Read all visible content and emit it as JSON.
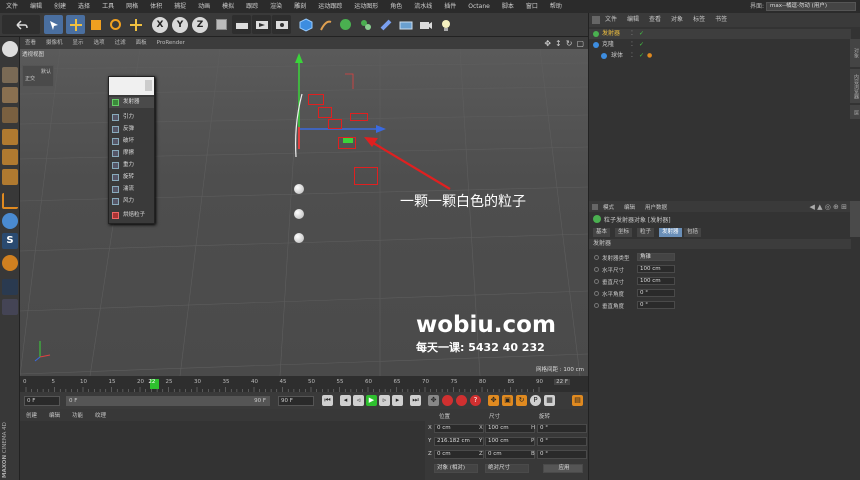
{
  "menubar": {
    "items": [
      "文件",
      "编辑",
      "创建",
      "选择",
      "工具",
      "网格",
      "体积",
      "捕捉",
      "动画",
      "模拟",
      "跟踪",
      "渲染",
      "雕刻",
      "运动跟踪",
      "运动图形",
      "角色",
      "流水线",
      "插件",
      "Octane",
      "脚本",
      "窗口",
      "帮助"
    ],
    "layout_label": "界面:",
    "layout_value": "max--橘逗-勿动 (用户)"
  },
  "viewport": {
    "menu": [
      "查看",
      "摄像机",
      "显示",
      "选项",
      "过滤",
      "面板",
      "ProRender"
    ],
    "title": "透视视图",
    "grid_info": "网格间距 : 100 cm",
    "mini_panel": "默认",
    "mini_value": "正交",
    "annotation": "一颗一颗白色的粒子",
    "watermark": "wobiu.com",
    "watermark_sub": "每天一课: 5432 40 232"
  },
  "popup": {
    "header": "",
    "items": [
      "发射器",
      "引力",
      "反弹",
      "破坏",
      "摩擦",
      "重力",
      "旋转",
      "湍流",
      "风力",
      "烘焙粒子"
    ]
  },
  "timeline": {
    "ticks": [
      "0",
      "5",
      "10",
      "15",
      "20",
      "22",
      "25",
      "30",
      "35",
      "40",
      "45",
      "50",
      "55",
      "60",
      "65",
      "70",
      "75",
      "80",
      "85",
      "90"
    ],
    "current_frame": "22",
    "end_label": "22 F"
  },
  "transport": {
    "start": "0 F",
    "min": "0 F",
    "max": "90 F",
    "end": "90 F"
  },
  "material": {
    "menu": [
      "创建",
      "编辑",
      "功能",
      "纹理"
    ]
  },
  "coords": {
    "headers": [
      "位置",
      "尺寸",
      "旋转"
    ],
    "rows": [
      {
        "axis": "X",
        "pos": "0 cm",
        "size_axis": "X",
        "size": "100 cm",
        "rot_axis": "H",
        "rot": "0 °"
      },
      {
        "axis": "Y",
        "pos": "216.182 cm",
        "size_axis": "Y",
        "size": "100 cm",
        "rot_axis": "P",
        "rot": "0 °"
      },
      {
        "axis": "Z",
        "pos": "0 cm",
        "size_axis": "Z",
        "size": "0 cm",
        "rot_axis": "B",
        "rot": "0 °"
      }
    ],
    "mode_select": "对象 (相对)",
    "size_select": "绝对尺寸",
    "apply_button": "应用"
  },
  "objects": {
    "menu": [
      "文件",
      "编辑",
      "查看",
      "对象",
      "标签",
      "书签"
    ],
    "rows": [
      {
        "name": "发射器",
        "indent": 0,
        "selected": false
      },
      {
        "name": "克隆",
        "indent": 0,
        "selected": false
      },
      {
        "name": "球体",
        "indent": 1,
        "selected": false
      }
    ]
  },
  "attributes": {
    "menu": [
      "模式",
      "编辑",
      "用户数据"
    ],
    "object_title": "粒子发射器对象 [发射器]",
    "tabs": [
      "基本",
      "坐标",
      "粒子",
      "发射器",
      "包括"
    ],
    "active_tab": "发射器",
    "section": "发射器",
    "props": [
      {
        "label": "发射器类型",
        "value": "角锥"
      },
      {
        "label": "水平尺寸",
        "value": "100 cm"
      },
      {
        "label": "垂直尺寸",
        "value": "100 cm"
      },
      {
        "label": "水平角度",
        "value": "0 °"
      },
      {
        "label": "垂直角度",
        "value": "0 °"
      }
    ]
  },
  "side_tabs": [
    "对象",
    "内容浏览器",
    "层"
  ],
  "brand": {
    "maxon": "MAXON",
    "product": "CINEMA 4D"
  }
}
